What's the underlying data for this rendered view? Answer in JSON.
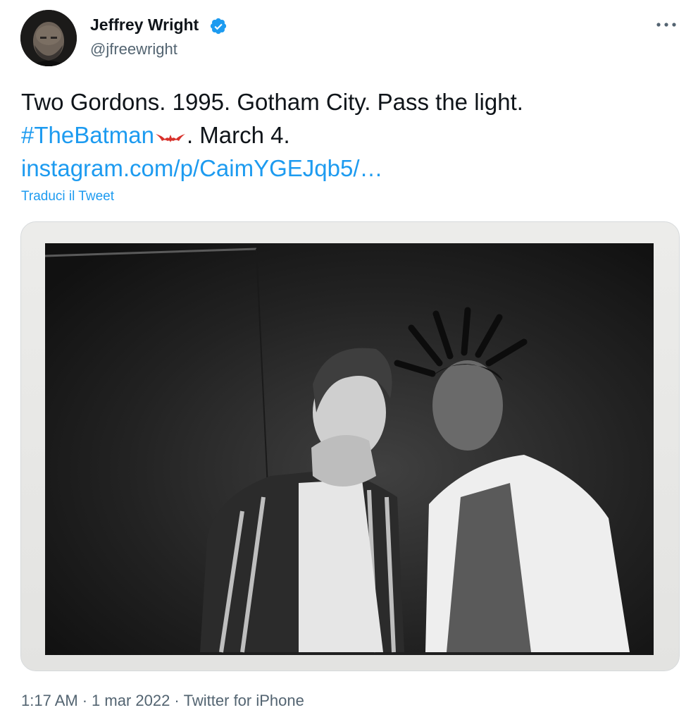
{
  "author": {
    "name": "Jeffrey Wright",
    "handle": "@jfreewright",
    "verified": true
  },
  "menu": {
    "icon": "more-horizontal-icon"
  },
  "tweet": {
    "line1": "Two Gordons. 1995. Gotham City. Pass the light.",
    "hashtag": "#TheBatman",
    "hashtag_emoji": "batman-hashflag-icon",
    "line2_rest": ". March 4.",
    "link": "instagram.com/p/CaimYGEJqb5/…",
    "translate_label": "Traduci il Tweet"
  },
  "media": {
    "type": "black-and-white photo"
  },
  "footer": {
    "time": "1:17 AM",
    "date": "1 mar 2022",
    "separator": "·",
    "source": "Twitter for iPhone"
  },
  "colors": {
    "link": "#1d9bf0",
    "text": "#0f1419",
    "secondary": "#536471",
    "bat_red": "#d8312b"
  }
}
